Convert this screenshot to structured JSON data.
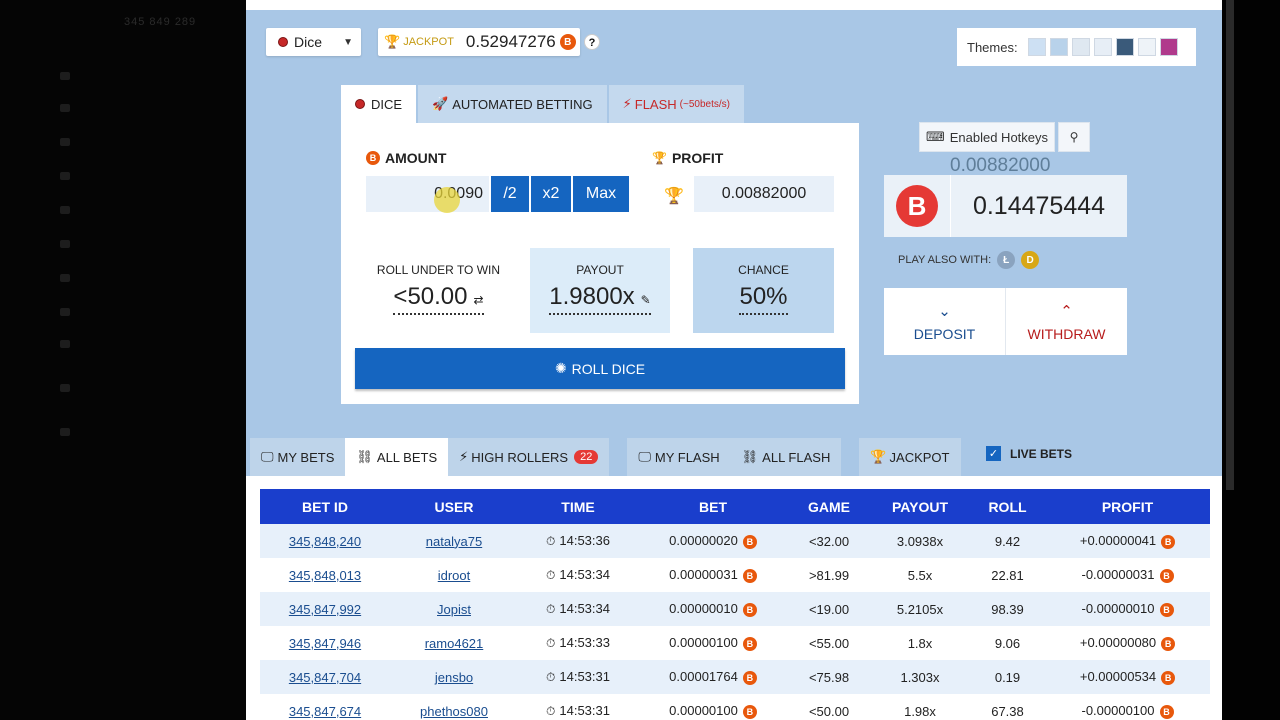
{
  "header": {
    "game_select": "Dice",
    "jackpot_label": "JACKPOT",
    "jackpot_value": "0.52947276",
    "help": "?",
    "themes_label": "Themes:",
    "theme_colors": [
      "#cde0f3",
      "#b8d2ea",
      "#dfe8f1",
      "#e7eef6",
      "#3a5a7a",
      "#eef3f8",
      "#b03a8c"
    ]
  },
  "sidebar": {
    "faint_text": "345 849 289"
  },
  "dice_tabs": [
    {
      "label": "DICE"
    },
    {
      "label": "AUTOMATED BETTING"
    },
    {
      "label": "FLASH",
      "sub": "(~50bets/s)"
    }
  ],
  "dice": {
    "amount_label": "AMOUNT",
    "amount_value": "0.0090",
    "half_label": "/2",
    "double_label": "x2",
    "max_label": "Max",
    "profit_label": "PROFIT",
    "profit_value": "0.00882000",
    "roll_under_label": "ROLL UNDER TO WIN",
    "roll_under_value": "<50.00",
    "payout_label": "PAYOUT",
    "payout_value": "1.9800x",
    "chance_label": "CHANCE",
    "chance_value": "50%",
    "roll_button": "ROLL DICE"
  },
  "balance": {
    "hotkeys": "Enabled Hotkeys",
    "profit_float": "0.00882000",
    "currency_symbol": "B",
    "value": "0.14475444",
    "play_also": "PLAY ALSO WITH:",
    "deposit": "DEPOSIT",
    "withdraw": "WITHDRAW"
  },
  "bets_tabs": [
    {
      "label": "MY BETS"
    },
    {
      "label": "ALL BETS"
    },
    {
      "label": "HIGH ROLLERS",
      "badge": "22"
    },
    {
      "label": "MY FLASH"
    },
    {
      "label": "ALL FLASH"
    },
    {
      "label": "JACKPOT"
    }
  ],
  "live_bets": "LIVE BETS",
  "table": {
    "headers": [
      "BET ID",
      "USER",
      "TIME",
      "BET",
      "GAME",
      "PAYOUT",
      "ROLL",
      "PROFIT"
    ],
    "rows": [
      {
        "id": "345,848,240",
        "user": "natalya75",
        "time": "14:53:36",
        "bet": "0.00000020",
        "game": "<32.00",
        "payout": "3.0938x",
        "roll": "9.42",
        "profit": "+0.00000041"
      },
      {
        "id": "345,848,013",
        "user": "idroot",
        "time": "14:53:34",
        "bet": "0.00000031",
        "game": ">81.99",
        "payout": "5.5x",
        "roll": "22.81",
        "profit": "-0.00000031"
      },
      {
        "id": "345,847,992",
        "user": "Jopist",
        "time": "14:53:34",
        "bet": "0.00000010",
        "game": "<19.00",
        "payout": "5.2105x",
        "roll": "98.39",
        "profit": "-0.00000010"
      },
      {
        "id": "345,847,946",
        "user": "ramo4621",
        "time": "14:53:33",
        "bet": "0.00000100",
        "game": "<55.00",
        "payout": "1.8x",
        "roll": "9.06",
        "profit": "+0.00000080"
      },
      {
        "id": "345,847,704",
        "user": "jensbo",
        "time": "14:53:31",
        "bet": "0.00001764",
        "game": "<75.98",
        "payout": "1.303x",
        "roll": "0.19",
        "profit": "+0.00000534"
      },
      {
        "id": "345,847,674",
        "user": "phethos080",
        "time": "14:53:31",
        "bet": "0.00000100",
        "game": "<50.00",
        "payout": "1.98x",
        "roll": "67.38",
        "profit": "-0.00000100"
      }
    ]
  }
}
